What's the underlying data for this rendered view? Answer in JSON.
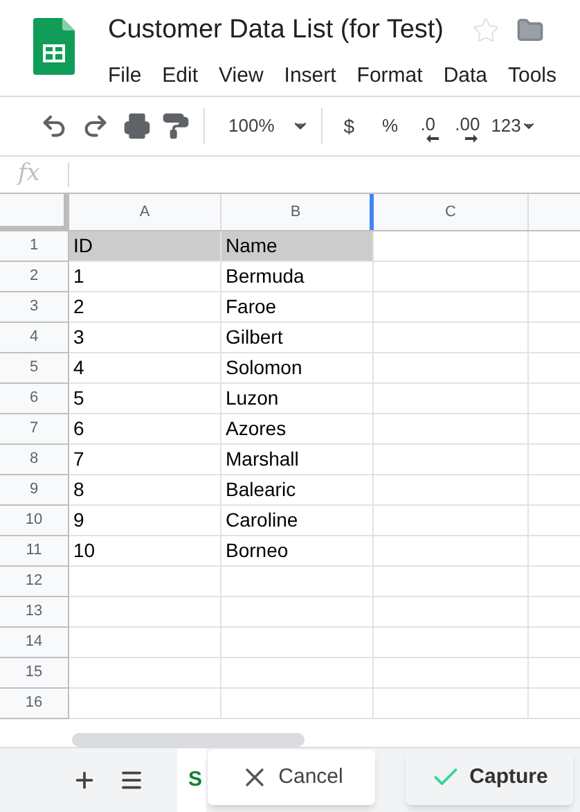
{
  "document": {
    "title": "Customer Data List (for Test)",
    "starred": false
  },
  "menu": [
    "File",
    "Edit",
    "View",
    "Insert",
    "Format",
    "Data",
    "Tools"
  ],
  "toolbar": {
    "zoom": "100%",
    "currency": "$",
    "percent": "%",
    "decrease_decimals": ".0",
    "increase_decimals": ".00",
    "more_formats": "123"
  },
  "formula_bar": {
    "fx": "fx"
  },
  "grid": {
    "columns": [
      "A",
      "B",
      "C"
    ],
    "rows": [
      {
        "number": "1",
        "cells": [
          "ID",
          "Name"
        ]
      },
      {
        "number": "2",
        "cells": [
          "1",
          "Bermuda"
        ]
      },
      {
        "number": "3",
        "cells": [
          "2",
          "Faroe"
        ]
      },
      {
        "number": "4",
        "cells": [
          "3",
          "Gilbert"
        ]
      },
      {
        "number": "5",
        "cells": [
          "4",
          "Solomon"
        ]
      },
      {
        "number": "6",
        "cells": [
          "5",
          "Luzon"
        ]
      },
      {
        "number": "7",
        "cells": [
          "6",
          "Azores"
        ]
      },
      {
        "number": "8",
        "cells": [
          "7",
          "Marshall"
        ]
      },
      {
        "number": "9",
        "cells": [
          "8",
          "Balearic"
        ]
      },
      {
        "number": "10",
        "cells": [
          "9",
          "Caroline"
        ]
      },
      {
        "number": "11",
        "cells": [
          "10",
          "Borneo"
        ]
      },
      {
        "number": "12"
      },
      {
        "number": "13"
      },
      {
        "number": "14"
      },
      {
        "number": "15"
      },
      {
        "number": "16"
      }
    ]
  },
  "sheet_tab": {
    "label": "S"
  },
  "overlay_buttons": [
    {
      "kind": "cancel",
      "label": "Cancel"
    },
    {
      "kind": "capture",
      "label": "Capture"
    }
  ]
}
